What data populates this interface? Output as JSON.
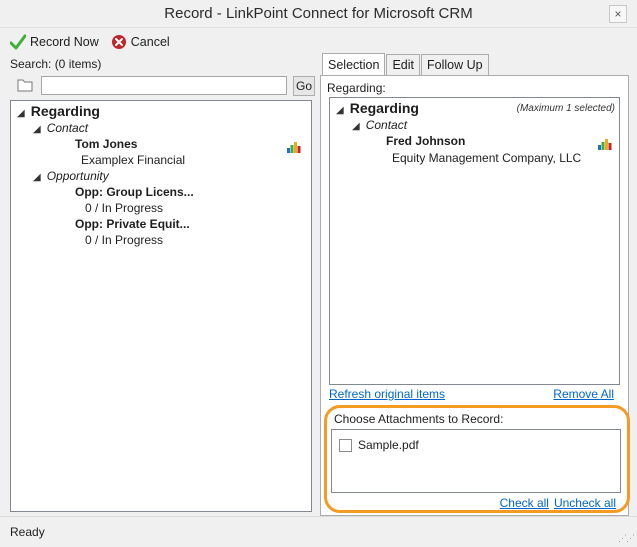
{
  "window": {
    "title": "Record - LinkPoint Connect for Microsoft CRM",
    "close_glyph": "×"
  },
  "toolbar": {
    "record_now_label": "Record Now",
    "cancel_label": "Cancel"
  },
  "left": {
    "search_label": "Search: (0 items)",
    "search_value": "",
    "go_label": "Go",
    "tree": {
      "root": "Regarding",
      "contact_category": "Contact",
      "contact_name": "Tom Jones",
      "contact_company": "Examplex Financial",
      "opportunity_category": "Opportunity",
      "opp1_name": "Opp: Group Licens...",
      "opp1_status": "0 / In Progress",
      "opp2_name": "Opp: Private Equit...",
      "opp2_status": "0 / In Progress"
    }
  },
  "right": {
    "tabs": [
      {
        "label": "Selection",
        "active": true
      },
      {
        "label": "Edit",
        "active": false
      },
      {
        "label": "Follow Up",
        "active": false
      }
    ],
    "regarding_label": "Regarding:",
    "regarding_tree": {
      "root": "Regarding",
      "max_note": "(Maximum 1 selected)",
      "contact_category": "Contact",
      "contact_name": "Fred Johnson",
      "contact_company": "Equity Management Company, LLC"
    },
    "refresh_link": "Refresh original items",
    "remove_all_link": "Remove All",
    "attachments_label": "Choose Attachments to Record:",
    "attachments": [
      {
        "name": "Sample.pdf",
        "checked": false
      }
    ],
    "check_all_link": "Check all",
    "uncheck_all_link": "Uncheck all"
  },
  "status": {
    "text": "Ready"
  },
  "colors": {
    "highlight": "#f59a23",
    "link": "#0066cc",
    "cancel_red": "#c0262b",
    "check_green": "#3fae3a"
  }
}
